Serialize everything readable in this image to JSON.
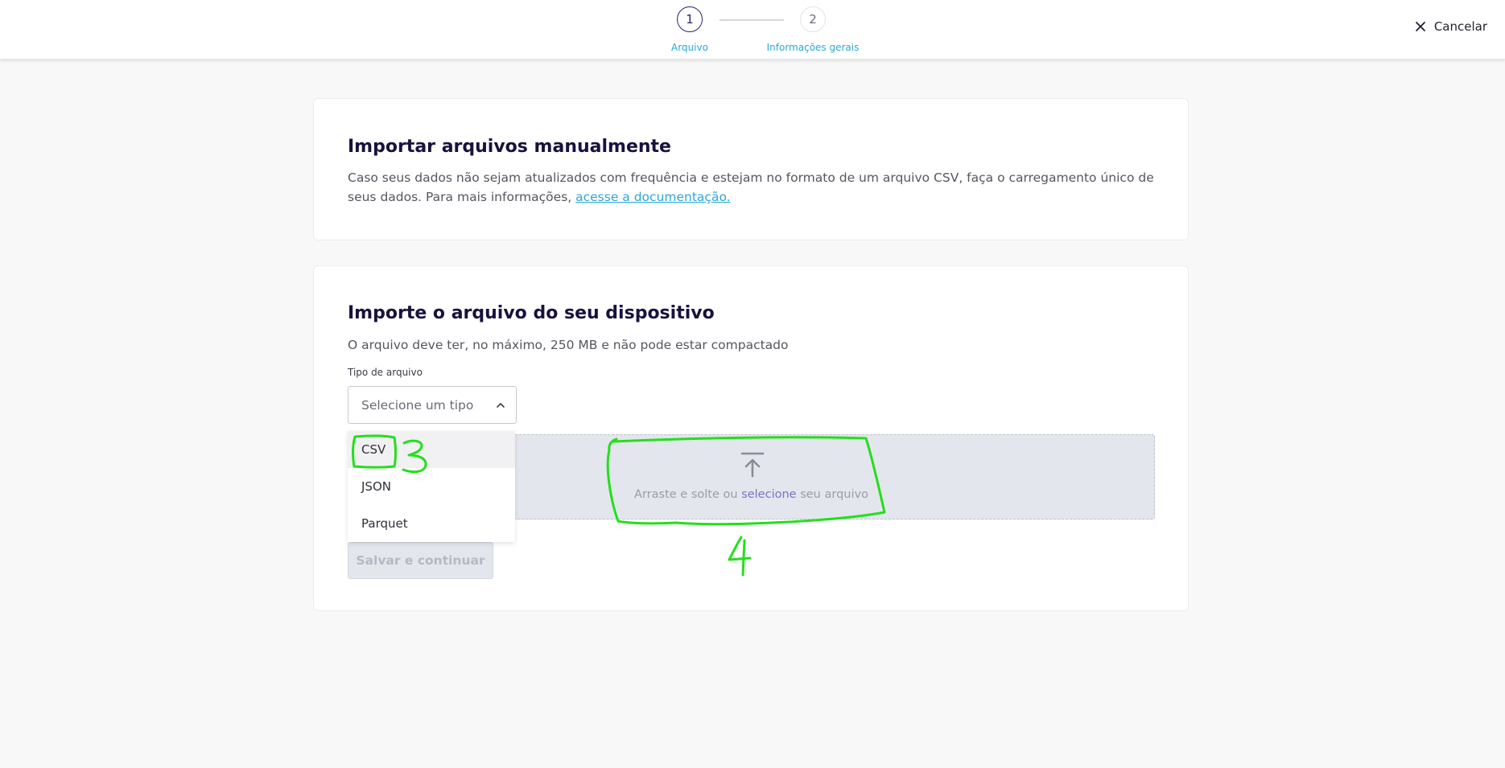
{
  "header": {
    "steps": [
      {
        "number": "1",
        "label": "Arquivo"
      },
      {
        "number": "2",
        "label": "Informações gerais"
      }
    ],
    "cancel_label": "Cancelar",
    "cancel_icon": "close-icon"
  },
  "manual_card": {
    "title": "Importar arquivos manualmente",
    "description": "Caso seus dados não sejam atualizados com frequência e estejam no formato de um arquivo CSV, faça o carregamento único de seus dados. Para mais informações, ",
    "link_text": "acesse a documentação."
  },
  "device_card": {
    "title": "Importe o arquivo do seu dispositivo",
    "description": "O arquivo deve ter, no máximo, 250 MB e não pode estar compactado",
    "file_type_label": "Tipo de arquivo",
    "select_placeholder": "Selecione um tipo",
    "options": [
      "CSV",
      "JSON",
      "Parquet"
    ],
    "dropzone": {
      "text_before": "Arraste e solte ou ",
      "link": "selecione",
      "text_after": " seu arquivo",
      "icon": "upload-icon"
    },
    "save_label": "Salvar e continuar"
  },
  "annotations": {
    "color": "#22e01a",
    "labels": [
      "3",
      "4"
    ]
  },
  "colors": {
    "primary": "#2c1f7a",
    "step_label": "#2aa8d8",
    "link": "#2aa8d8",
    "dropzone_bg": "#e4e6ee"
  }
}
